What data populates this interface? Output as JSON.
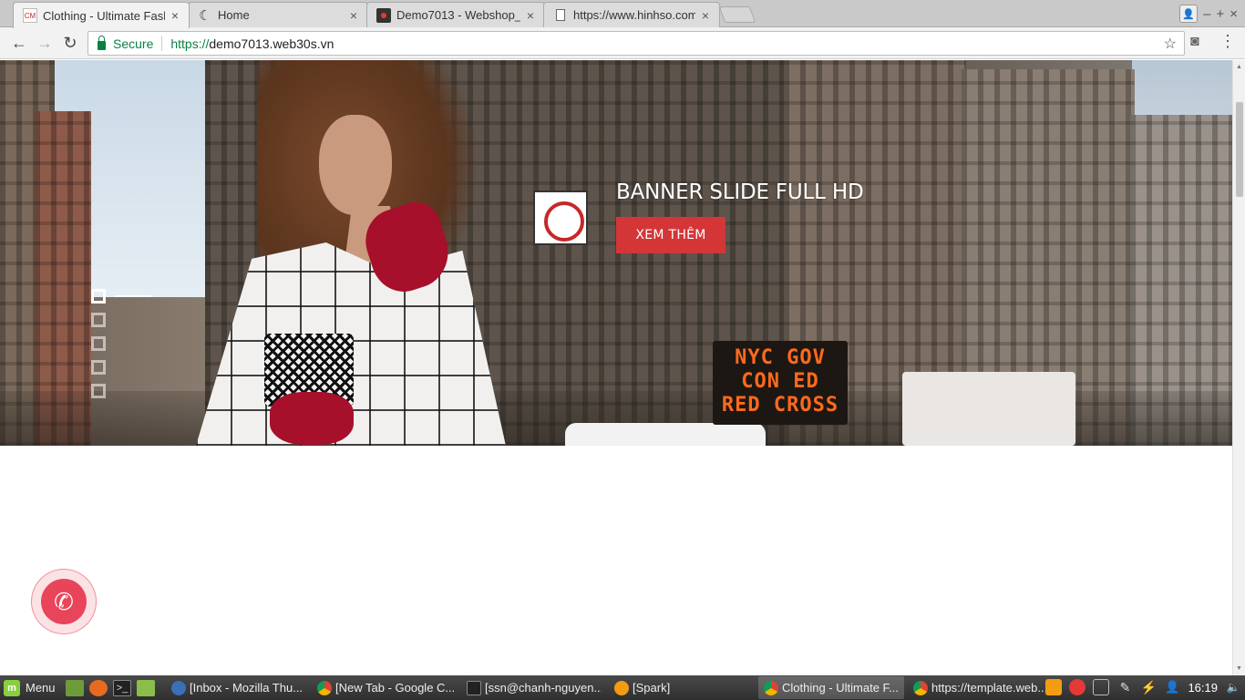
{
  "browser": {
    "tabs": [
      {
        "title": "Clothing - Ultimate Fash",
        "active": true
      },
      {
        "title": "Home",
        "active": false
      },
      {
        "title": "Demo7013 - Webshop_",
        "active": false
      },
      {
        "title": "https://www.hinhso.com",
        "active": false
      }
    ],
    "close_glyph": "×",
    "url_secure_label": "Secure",
    "url_scheme": "https://",
    "url_host": "demo7013.web30s.vn"
  },
  "page": {
    "banner": {
      "title": "BANNER SLIDE FULL HD",
      "button_label": "XEM THÊM",
      "sign_text": [
        "NYC GOV",
        "CON ED",
        "RED CROSS"
      ],
      "slides_total": 5,
      "active_slide": 1
    },
    "accent_color": "#d43638",
    "call_button_color": "#e8455a"
  },
  "taskbar": {
    "menu_label": "Menu",
    "tasks": [
      {
        "label": "[Inbox - Mozilla Thu..."
      },
      {
        "label": "[New Tab - Google C..."
      },
      {
        "label": "[ssn@chanh-nguyen..."
      },
      {
        "label": "[Spark]"
      },
      {
        "label": "Clothing - Ultimate F..."
      },
      {
        "label": "https://template.web..."
      }
    ],
    "clock": "16:19"
  }
}
